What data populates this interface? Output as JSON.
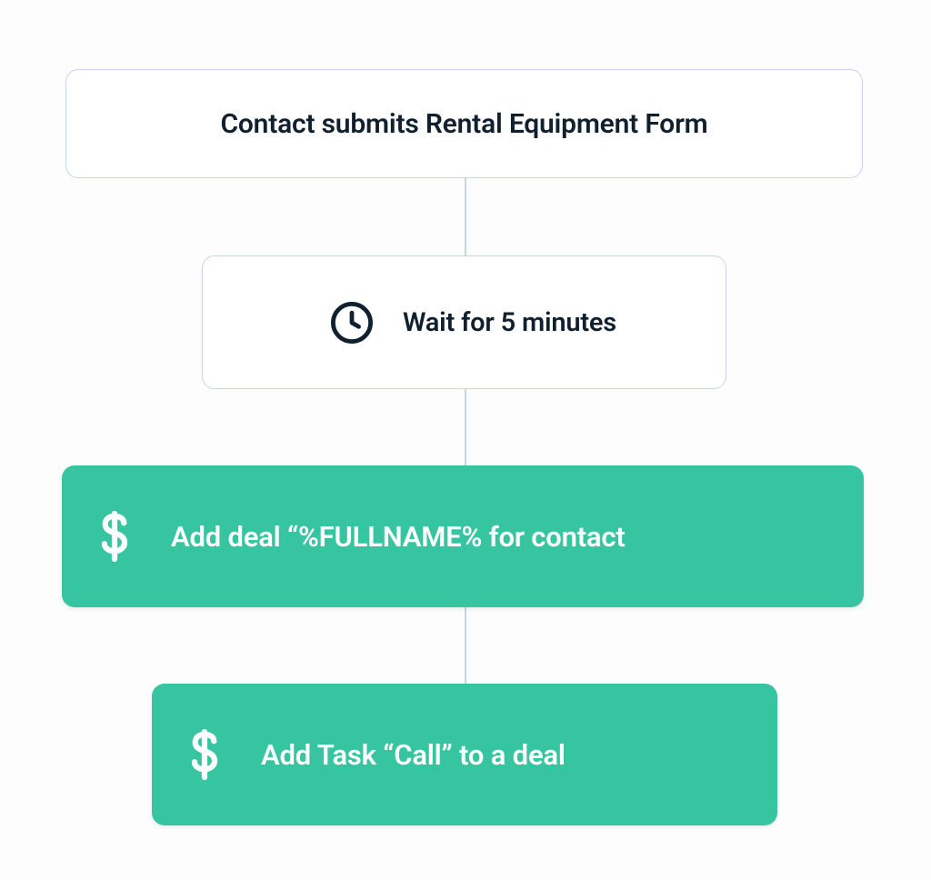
{
  "workflow": {
    "trigger": {
      "label": "Contact submits Rental Equipment Form"
    },
    "steps": [
      {
        "kind": "wait",
        "icon": "clock-icon",
        "label": "Wait for 5 minutes"
      },
      {
        "kind": "action",
        "icon": "dollar-icon",
        "label": "Add deal “%FULLNAME% for contact"
      },
      {
        "kind": "action",
        "icon": "dollar-icon",
        "label": "Add Task “Call” to a deal"
      }
    ]
  },
  "colors": {
    "node_border": "#c7d4f0",
    "text_dark": "#10202e",
    "action_bg": "#36c5a0",
    "action_fg": "#ffffff"
  }
}
